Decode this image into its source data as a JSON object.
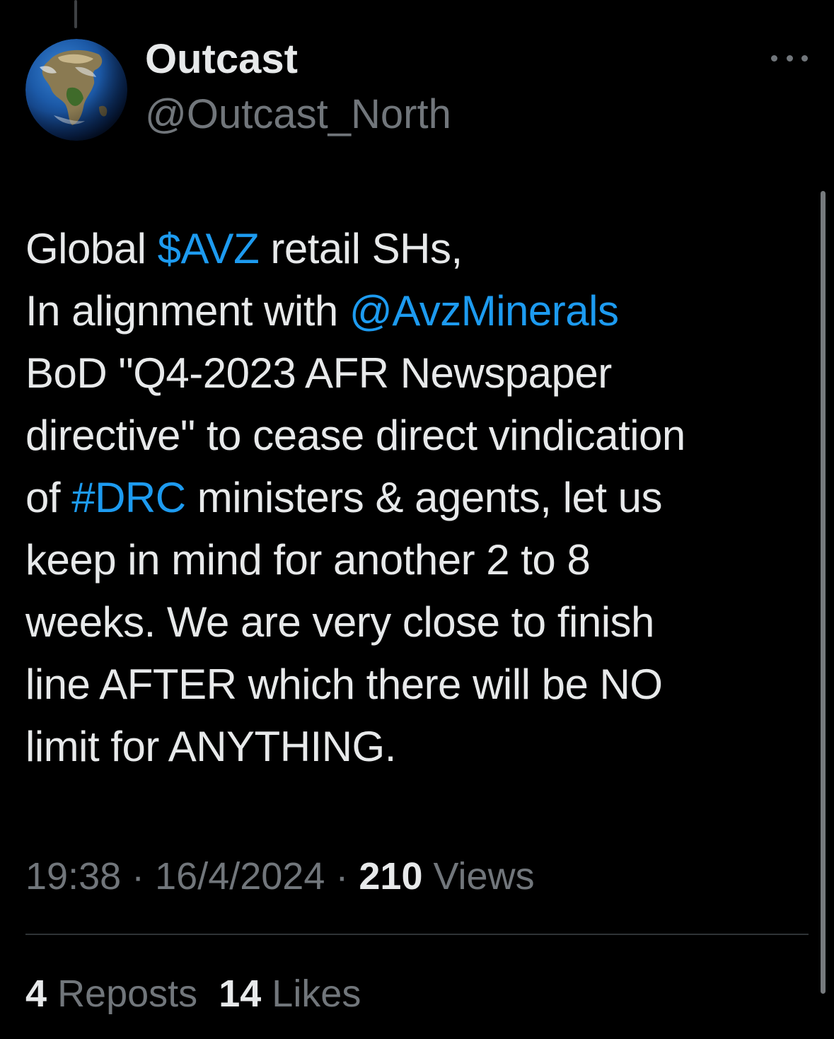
{
  "author": {
    "display_name": "Outcast",
    "handle": "@Outcast_North",
    "avatar_icon": "earth-globe-avatar"
  },
  "more_icon": "more-options-icon",
  "tweet": {
    "lines": [
      [
        {
          "t": "Global "
        },
        {
          "t": "$AVZ",
          "link": true
        },
        {
          "t": " retail SHs,"
        }
      ],
      [
        {
          "t": "In alignment with "
        },
        {
          "t": "@AvzMinerals",
          "link": true
        }
      ],
      [
        {
          "t": "BoD \"Q4-2023 AFR Newspaper"
        }
      ],
      [
        {
          "t": "directive\" to cease direct vindication"
        }
      ],
      [
        {
          "t": "of "
        },
        {
          "t": "#DRC",
          "link": true
        },
        {
          "t": " ministers & agents, let us"
        }
      ],
      [
        {
          "t": "keep in mind for another 2 to 8"
        }
      ],
      [
        {
          "t": "weeks. We are very close to finish"
        }
      ],
      [
        {
          "t": "line AFTER which there will be NO"
        }
      ],
      [
        {
          "t": "limit for ANYTHING."
        }
      ]
    ]
  },
  "meta": {
    "time": "19:38",
    "date": "16/4/2024",
    "sep": " · ",
    "views_count": "210",
    "views_label": "Views"
  },
  "stats": {
    "reposts_count": "4",
    "reposts_label": "Reposts",
    "likes_count": "14",
    "likes_label": "Likes"
  },
  "colors": {
    "background": "#000000",
    "text_primary": "#e7e9ea",
    "text_secondary": "#71767b",
    "link": "#1d9bf0",
    "divider": "#2f3336"
  }
}
